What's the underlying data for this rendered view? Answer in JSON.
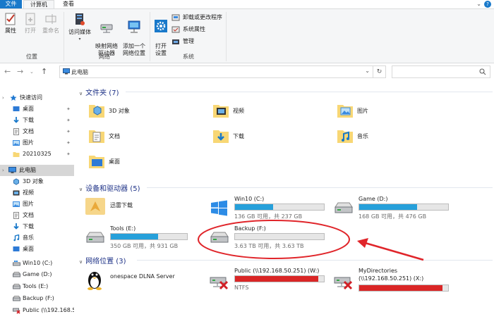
{
  "ribbon": {
    "tabs": [
      "文件",
      "计算机",
      "查看"
    ],
    "groups": {
      "location": {
        "label": "位置",
        "buttons": [
          "属性",
          "打开",
          "重命名"
        ]
      },
      "network": {
        "label": "网络",
        "buttons": [
          "访问媒体",
          "映射网络\n驱动器",
          "添加一个\n网络位置"
        ]
      },
      "system": {
        "label": "系统",
        "open_settings": "打开\n设置",
        "small": [
          "卸载或更改程序",
          "系统属性",
          "管理"
        ]
      }
    }
  },
  "address": {
    "path": "此电脑",
    "search_placeholder": ""
  },
  "sidebar": {
    "items": [
      {
        "label": "快速访问",
        "icon": "star-icon"
      },
      {
        "label": "桌面",
        "icon": "desktop-icon",
        "pinned": true
      },
      {
        "label": "下载",
        "icon": "download-icon",
        "pinned": true
      },
      {
        "label": "文档",
        "icon": "document-icon",
        "pinned": true
      },
      {
        "label": "图片",
        "icon": "picture-icon",
        "pinned": true
      },
      {
        "label": "20210325",
        "icon": "folder-icon",
        "pinned": true
      },
      {
        "label": "此电脑",
        "icon": "computer-icon",
        "selected": true
      },
      {
        "label": "3D 对象",
        "icon": "3d-objects-icon"
      },
      {
        "label": "视频",
        "icon": "video-icon"
      },
      {
        "label": "图片",
        "icon": "picture-icon"
      },
      {
        "label": "文档",
        "icon": "document-icon"
      },
      {
        "label": "下载",
        "icon": "download-icon"
      },
      {
        "label": "音乐",
        "icon": "music-icon"
      },
      {
        "label": "桌面",
        "icon": "desktop-icon"
      },
      {
        "label": "Win10 (C:)",
        "icon": "drive-c-icon"
      },
      {
        "label": "Game (D:)",
        "icon": "drive-icon"
      },
      {
        "label": "Tools (E:)",
        "icon": "drive-icon"
      },
      {
        "label": "Backup (F:)",
        "icon": "drive-icon"
      },
      {
        "label": "Public (\\\\192.168.5",
        "icon": "network-drive-icon"
      }
    ]
  },
  "content": {
    "folders_header": "文件夹 (7)",
    "folders": [
      "3D 对象",
      "视频",
      "图片",
      "文档",
      "下载",
      "音乐",
      "桌面"
    ],
    "devices_header": "设备和驱动器 (5)",
    "devices": [
      {
        "name": "迅雷下载",
        "type": "app"
      },
      {
        "name": "Win10 (C:)",
        "info": "136 GB 可用，共 237 GB",
        "used_fraction": 0.43
      },
      {
        "name": "Game (D:)",
        "info": "168 GB 可用，共 476 GB",
        "used_fraction": 0.65
      },
      {
        "name": "Tools (E:)",
        "info": "350 GB 可用，共 931 GB",
        "used_fraction": 0.62
      },
      {
        "name": "Backup (F:)",
        "info": "3.63 TB 可用，共 3.63 TB",
        "used_fraction": 0.0
      }
    ],
    "network_header": "网络位置 (3)",
    "network": [
      {
        "name": "onespace DLNA Server"
      },
      {
        "name": "Public (\\\\192.168.50.251) (W:)",
        "info": "NTFS",
        "used_fraction": 0.94,
        "bar_color": "#da2626"
      },
      {
        "name": "MyDirectories",
        "name2": "(\\\\192.168.50.251) (X:)",
        "used_fraction": 0.94,
        "bar_color": "#da2626"
      }
    ]
  },
  "colors": {
    "accent": "#1979ca",
    "drive_bar": "#26a0da",
    "drive_bar_full": "#da2626",
    "annotation": "#e0252a"
  }
}
